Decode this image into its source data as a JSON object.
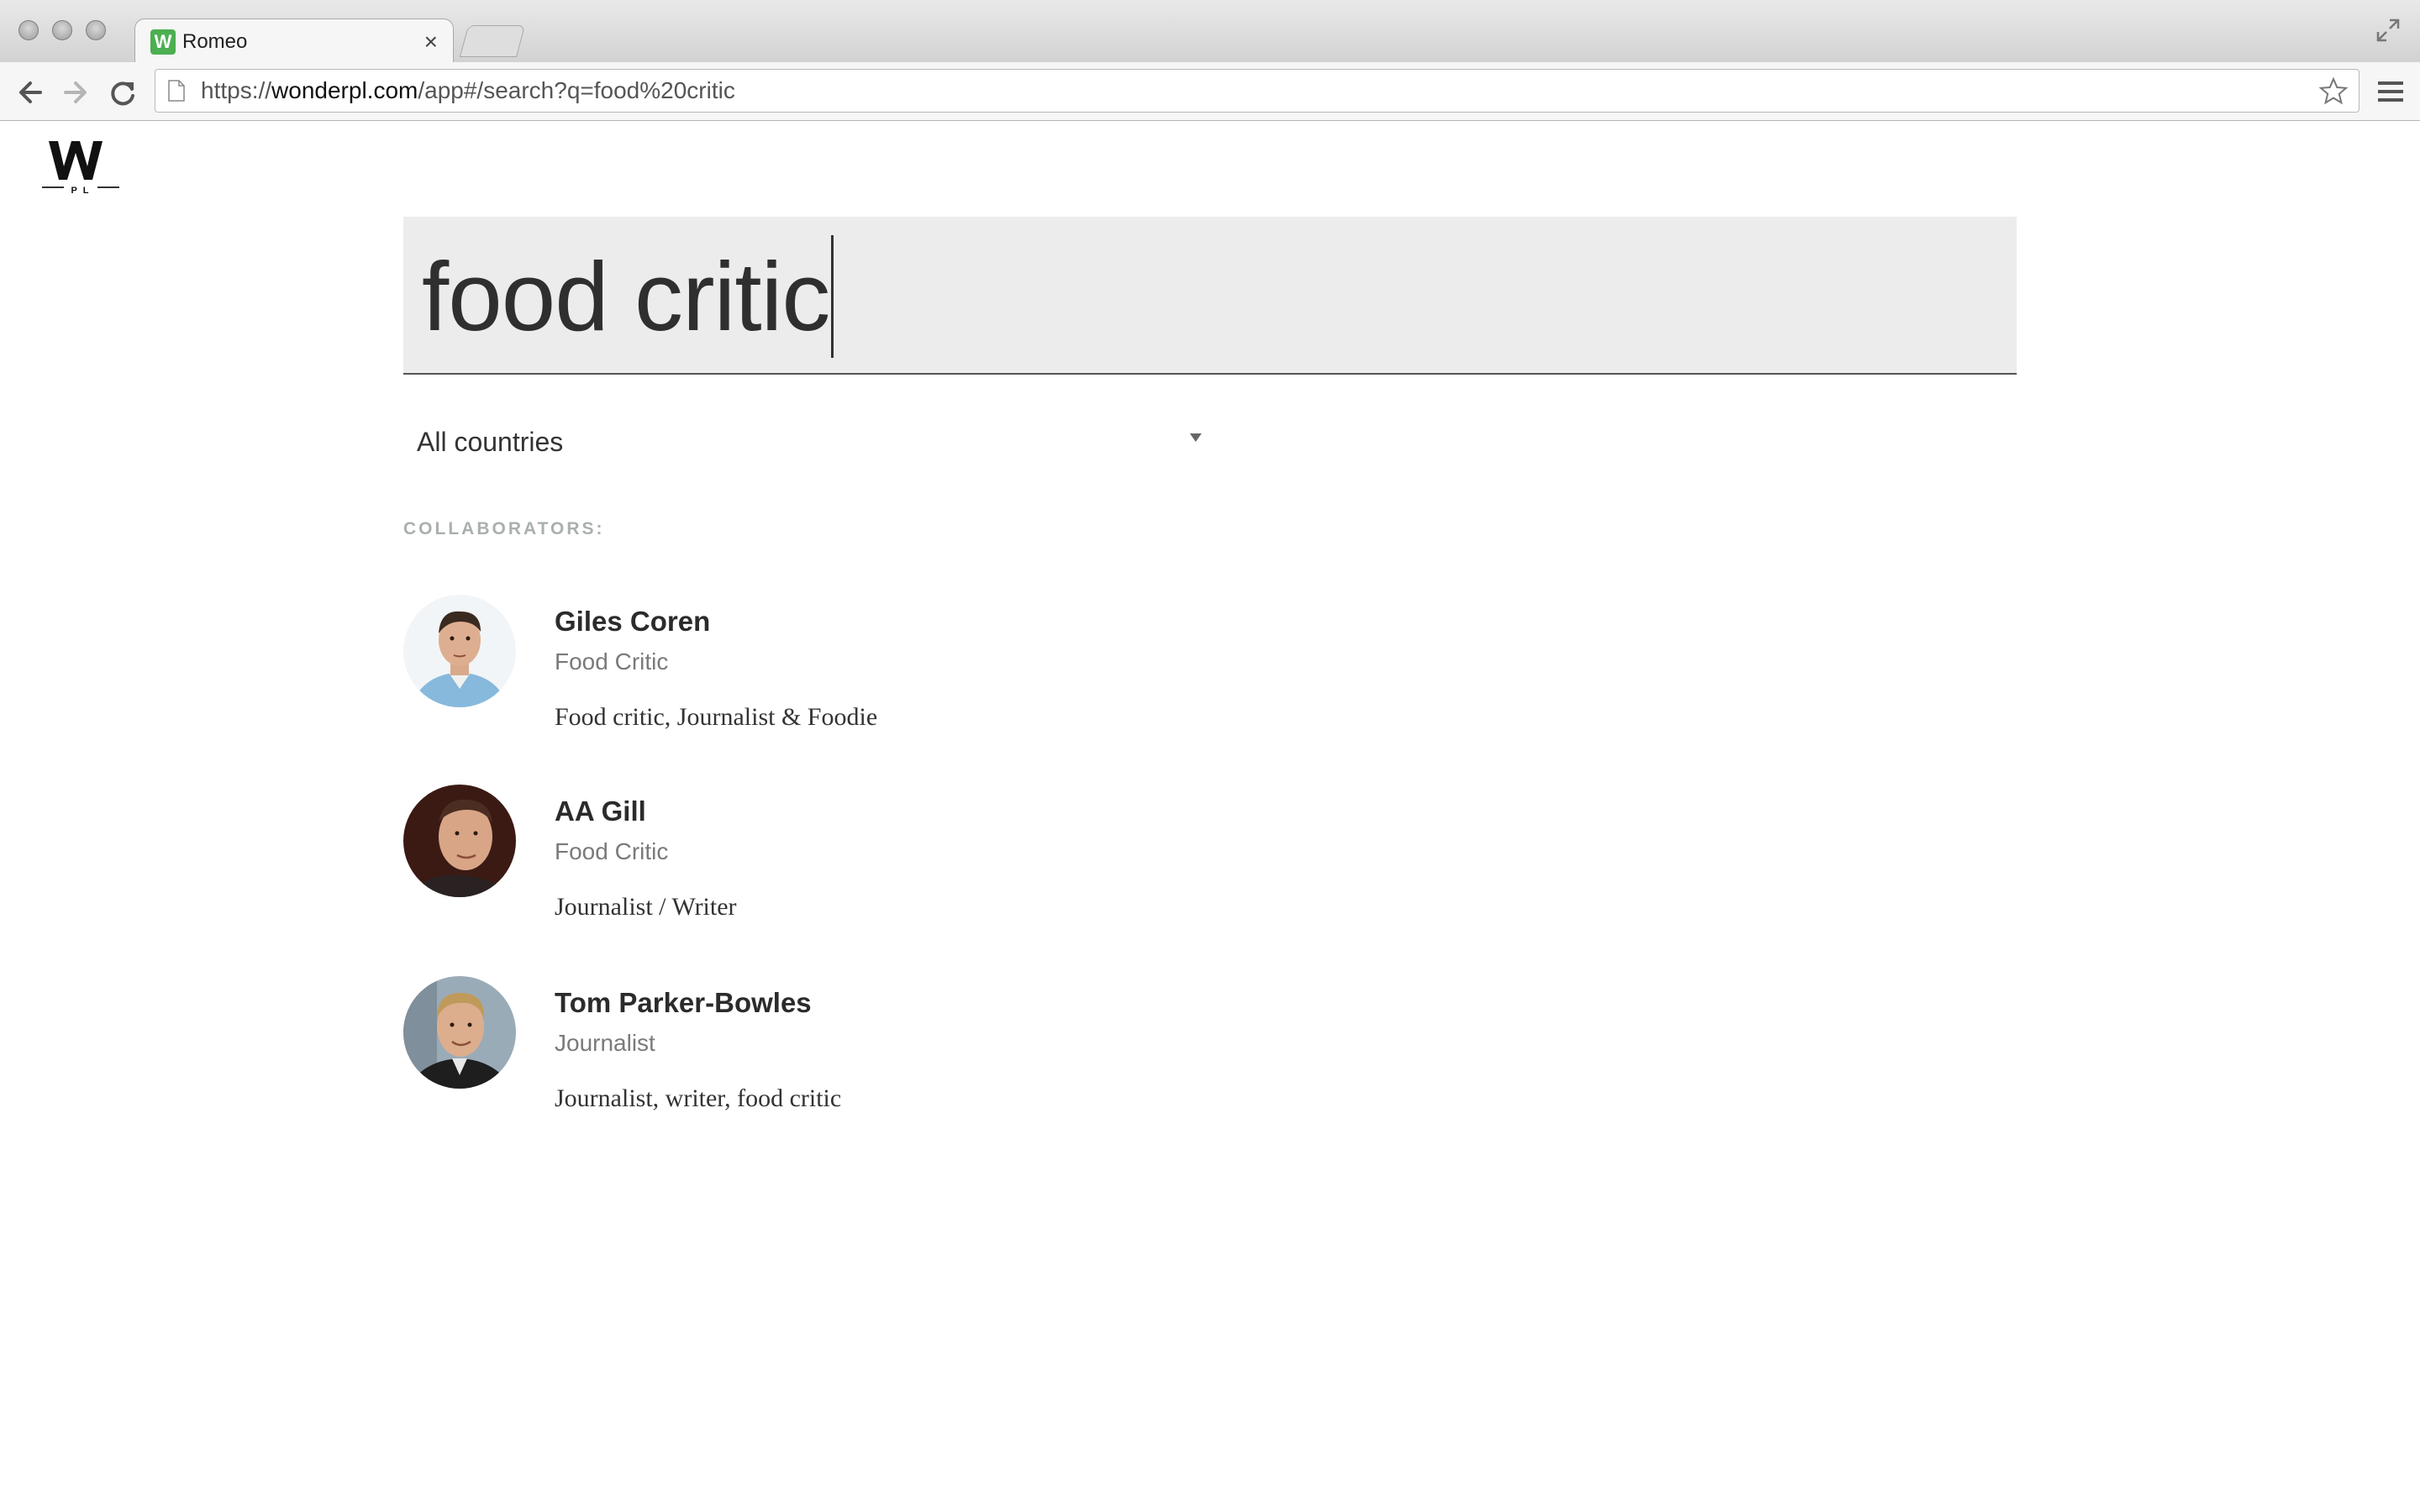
{
  "browser": {
    "tab_title": "Romeo",
    "tab_favicon_letter": "W",
    "tab_close_glyph": "×",
    "url_scheme": "https://",
    "url_host": "wonderpl.com",
    "url_path": "/app#/search?q=food%20critic",
    "icons": [
      "back-icon",
      "forward-icon",
      "reload-icon",
      "page-icon",
      "star-icon",
      "menu-icon",
      "fullscreen-icon"
    ]
  },
  "app": {
    "logo_letter": "W",
    "logo_sub": "P L"
  },
  "search": {
    "query": "food critic"
  },
  "filter": {
    "country_selected": "All countries"
  },
  "results": {
    "heading": "COLLABORATORS:",
    "items": [
      {
        "name": "Giles Coren",
        "role": "Food Critic",
        "bio": "Food critic, Journalist & Foodie",
        "avatar_bg": "#dfe9ef",
        "avatar_shirt": "#7fb6d9"
      },
      {
        "name": "AA Gill",
        "role": "Food Critic",
        "bio": "Journalist / Writer",
        "avatar_bg": "#3b1a14",
        "avatar_shirt": "#2a2a2a"
      },
      {
        "name": "Tom Parker-Bowles",
        "role": "Journalist",
        "bio": "Journalist, writer, food critic",
        "avatar_bg": "#8ea3b3",
        "avatar_shirt": "#1e1e1e"
      }
    ]
  },
  "colors": {
    "search_bg": "#ebeceb",
    "heading": "#a9b0ae",
    "role_text": "#7a7a7a"
  }
}
